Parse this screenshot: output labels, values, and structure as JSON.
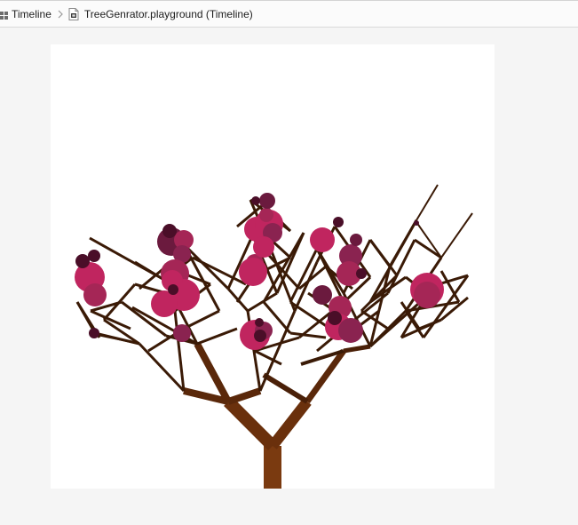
{
  "breadcrumb": {
    "items": [
      {
        "label": "Timeline",
        "icon": "grid-icon"
      },
      {
        "label": "TreeGenrator.playground (Timeline)",
        "icon": "playground-file-icon"
      }
    ],
    "separator_icon": "chevron-right-icon"
  },
  "canvas": {
    "background": "#ffffff",
    "trunk_color": "#7a3a10",
    "branch_color": "#3a1a06",
    "blossom_colors": [
      "#c0255f",
      "#a52656",
      "#8a2350",
      "#6b1a3e",
      "#4a0e28"
    ]
  }
}
